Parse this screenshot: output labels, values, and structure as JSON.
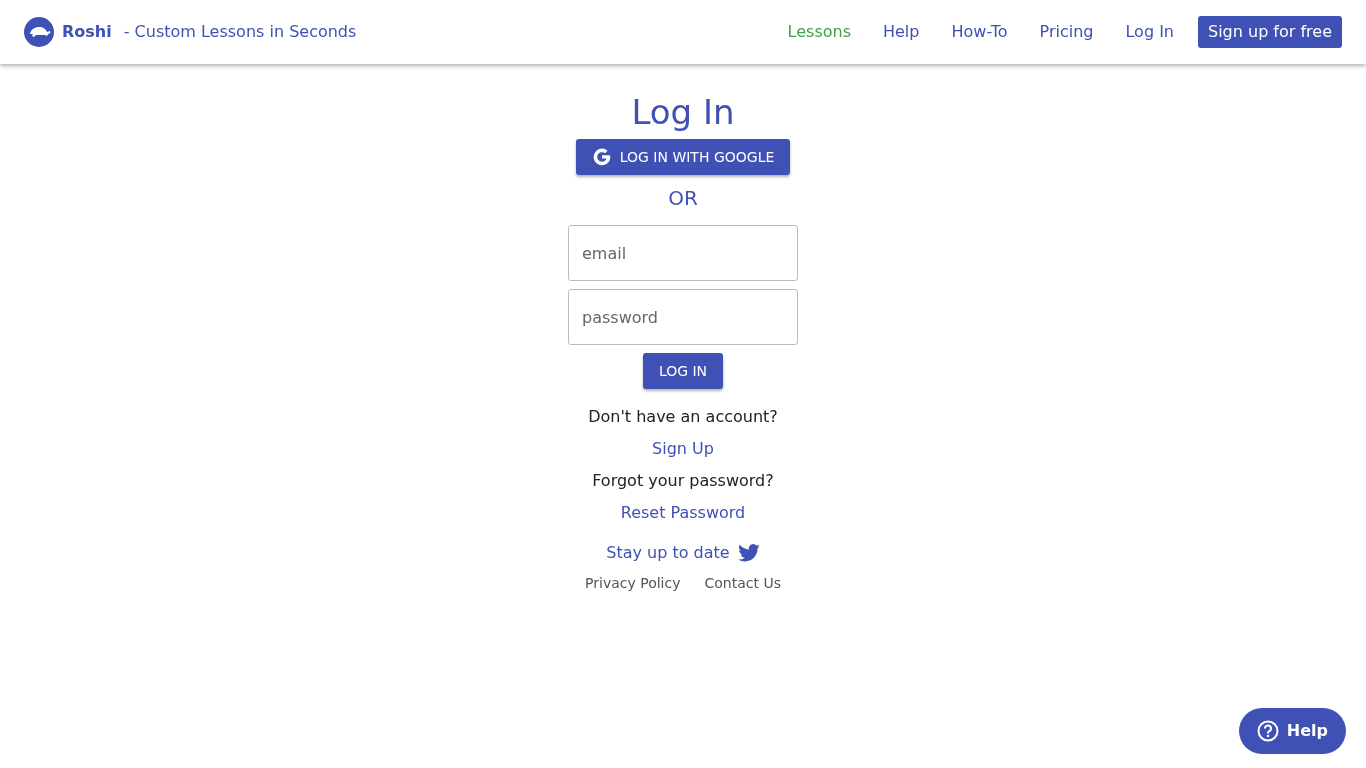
{
  "brand": {
    "name": "Roshi",
    "tagline": "- Custom Lessons in Seconds"
  },
  "nav": [
    {
      "label": "Lessons",
      "kind": "link",
      "selected": true
    },
    {
      "label": "Help",
      "kind": "link",
      "selected": false
    },
    {
      "label": "How-To",
      "kind": "link",
      "selected": false
    },
    {
      "label": "Pricing",
      "kind": "link",
      "selected": false
    },
    {
      "label": "Log In",
      "kind": "link",
      "selected": false
    },
    {
      "label": "Sign up for free",
      "kind": "button",
      "selected": false
    }
  ],
  "login": {
    "title": "Log In",
    "google_button": "LOG IN WITH GOOGLE",
    "or": "OR",
    "email": {
      "placeholder": "email"
    },
    "password": {
      "placeholder": "password"
    },
    "submit": "LOG IN",
    "no_account": "Don't have an account?",
    "sign_up": "Sign Up",
    "forgot": "Forgot your password?",
    "reset": "Reset Password"
  },
  "footer": {
    "twitter": "Stay up to date",
    "links": [
      "Privacy Policy",
      "Contact Us"
    ]
  },
  "help_button": "Help"
}
